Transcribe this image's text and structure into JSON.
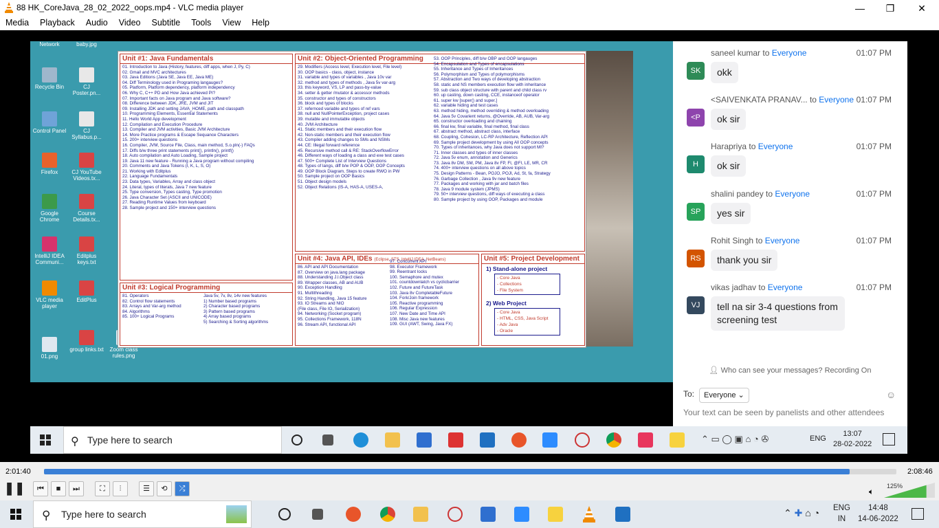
{
  "window": {
    "title": "88 HK_CoreJava_28_02_2022_oops.mp4 - VLC media player",
    "minimize": "—",
    "maximize": "❐",
    "close": "✕"
  },
  "menu": [
    "Media",
    "Playback",
    "Audio",
    "Video",
    "Subtitle",
    "Tools",
    "View",
    "Help"
  ],
  "desktop_icons": [
    {
      "label": "Network",
      "color": "#4a6fa5"
    },
    {
      "label": "baby.jpg",
      "color": "#d8c9a0"
    },
    {
      "label": "Recycle Bin",
      "color": "#9fb7cc"
    },
    {
      "label": "CJ Poster.pn...",
      "color": "#e8e8e8"
    },
    {
      "label": "Control Panel",
      "color": "#6fa3d8"
    },
    {
      "label": "CJ Syllabus.p...",
      "color": "#e8e8e8"
    },
    {
      "label": "Firefox",
      "color": "#e8622b"
    },
    {
      "label": "CJ YouTube Videos.tx...",
      "color": "#d94444"
    },
    {
      "label": "Google Chrome",
      "color": "#3c9a4a"
    },
    {
      "label": "Course Details.tx...",
      "color": "#d94444"
    },
    {
      "label": "IntelliJ IDEA Communi...",
      "color": "#d6336c"
    },
    {
      "label": "Editplus keys.txt",
      "color": "#d94444"
    },
    {
      "label": "VLC media player",
      "color": "#f08a00"
    },
    {
      "label": "EditPlus",
      "color": "#d94444"
    },
    {
      "label": "01.png",
      "color": "#dfe8f0"
    },
    {
      "label": "group links.txt",
      "color": "#d94444"
    },
    {
      "label": "Zoom class rules.png",
      "color": "#dfe8f0"
    }
  ],
  "slide": {
    "unit1": {
      "title": "Unit #1: Java Fundamentals",
      "items": [
        "01. Introduction to Java (History, features, diff apps, when J, Py, C)",
        "02. Gmail and MVC architectures",
        "03. Java Editions (Java SE, Java EE, Java ME)",
        "04. Diff Terminology used in Programing langauges?",
        "05. Platform, Platform dependency, platform independency",
        "06. Why C, C++ PD and How Java achieved PI?",
        "07. Important facts on Java program and Java software?",
        "08. Difference between JDK, JRE, JVM and JIT",
        "09. Installing JDK and setting JAVA_HOME, path and classpath",
        "10. Programming Elements, Essential Statements",
        "11. Hello World App development",
        "12. Compilation and Execution Procedure",
        "13. Compiler and JVM activities, Basic JVM Architecture",
        "14. More Practice programs & Escape Sequance Characters",
        "15. 200+ interview questions",
        "16. Compiler, JVM, Source File, Class, main method, S.o.pln(-) FAQs",
        "17. Diffs b/w three print statements print(), println(), printf()",
        "18. Auto compilation and Auto Loading, Sample project",
        "19. Java 11 new feature - Running a Java program without compiling",
        "20. Comments and Java Tokens (I, K, L, S, O)",
        "21. Working with Editplus",
        "22. Language Fundamentals",
        "23. Data types, Variables, Array and class object",
        "24. Literal, types of literals, Java 7 new feature",
        "25. Type conversion, Types casting, Type promotion",
        "26. Java Character Set (ASCII and UNICODE)",
        "27. Reading Runtime Values from keyboard",
        "28. Sample project and 150+ interview questions"
      ]
    },
    "unit2": {
      "title": "Unit #2: Object-Oriented Programming",
      "items": [
        "29. Modifiers (Access level, Execution level, File level)",
        "30. OOP basics - class, object, instance",
        "31. variable and types of variables , Java 10v var",
        "32. method and types of methods , Java 5v var-arg",
        "33. this keyword, VS, LP and pass-by-value",
        "34. setter & getter /mutator & accessor methods",
        "35. constructor and types of constructors",
        "36. block and types of blocks",
        "37. refernced variable and types of ref vars",
        "38. null and NullPointerException, project cases",
        "39. mutable and immutable objects",
        "40. JVM Architecture",
        "41. Static members and their execution flow",
        "42. Non-static members and their execution flow",
        "43. Compiler adding changes to SMs and NSMs",
        "44. CE: Illegal forward reference",
        "45. Recursive method call & RE: StackOverflowError",
        "46. Different ways of loading a class and exe test cases",
        "47. 500+ Complete List of Interview Questions",
        "48. Types of langs, diff b/w POP & OOP, OOP Concepts",
        "49. OOP Block Diagram, Steps to create RWO in PW",
        "50. Sample project on OOP Basics",
        "51. Object design models",
        "52. Object Relations (IS-A, HAS-A, USES-A,"
      ]
    },
    "unit2b": {
      "items": [
        "53. OOP Principles, diff b/w OBP and OOP langauges",
        "54. Encapsulation and Types of encapsulations",
        "55. Inheritance and Types of Inheritances",
        "56. Polymorphism and Types of polymorphisms",
        "57. Abstraction and Two ways of developing abstraction",
        "58. static and NS members execution flow with inheritance",
        "59. sub class object structure with parent and child class rv",
        "60. up casting, down casting, CCE, instanceof operator",
        "61. super kw [super() and super.]",
        "62. variable hiding and test cases",
        "63. method hiding, method overriding & method overloading",
        "64. Java 5v Covarient returns, @Override, AB, AUB, Var-arg",
        "65. constructor overloading and chaining",
        "66. final kw, final variable, final method, final class",
        "67. abstract method, abstract class, interface",
        "68. Coupling, Cohesion, LC-RP Architecture, Reflection API",
        "69. Sample project development by using All OOP concepts",
        "70. Types of inheritances, why Java does not support MI?",
        "71. Inner classes and types of inner classes",
        "72. Java 5v enum, annotation and Generics",
        "73. Java 8v DM, SM, PM, Java 8v FP, FI, @FI, LE, MR, CR",
        "74. 400+ interview questions on all above topics",
        "75. Design Patterns - Bean, POJO, POJI, Ad, St, fa, Strategy",
        "76. Garbage Collection , Java 9v new feature",
        "77. Packages and working with jar and batch files",
        "78. Java 9 module system (JPMS)",
        "79. 50+ interview questions, diff ways of executing a class",
        "80. Sample project by using OOP, Packages and module"
      ]
    },
    "unit3": {
      "title": "Unit #3: Logical Programming",
      "items": [
        "81. Operators",
        "82. Control flow statements",
        "83. Arrays and Var-arg method",
        "84. Algorithms",
        "85. 100+ Logical Programs"
      ],
      "sub": [
        "Java 5v, 7v, 8v, 14v new features",
        "1) Number based programs",
        "2) Character based programs",
        "3) Pattern based programs",
        "4) Array based programs",
        "5) Searching & Sorting algorithms"
      ]
    },
    "unit4": {
      "title": "Unit #4: Java API, IDEs",
      "subtitle": "(Eclipse, STS, IntelliJ IDEA, NetBeans)",
      "items": [
        "86. API and API Documentation",
        "87. Overview on java.lang package",
        "88. Understanding J.l.Object class",
        "89. Wrapper classes, AB and AUB",
        "90. Exception Handling",
        "91. Multithreading",
        "92. String Handling, Java 15 feature",
        "93. IO Streams and NIO",
        "(File class, File IO, Serialization)",
        "94. Networking (Socket program)",
        "95. Collections Framework, 118N",
        "96. Stream API, functional API"
      ],
      "items2": [
        "97. Concurrent API",
        "98. Executor Framework",
        "99. Reentrant locks",
        "100. Semaphore and mutex",
        "101. countdownlatch vs cyclicbarrier",
        "102. Future and FutureTask",
        "103. Java 8v CompletableFuture",
        "104. Fork/Join framework",
        "105. Reactive programming",
        "106. Regular Expression",
        "107. New Date and Time API",
        "108. Misc Java new features",
        "109. GUI (AWT, Swing, Java FX)"
      ]
    },
    "unit5": {
      "title": "Unit #5: Project Development",
      "standalone": "1) Stand-alone project",
      "standalone_items": [
        "- Core Java",
        "- Collections",
        "- File System"
      ],
      "web": "2) Web Project",
      "web_items": [
        "- Core Java",
        "- HTML, CSS, Java Script",
        "- Adv Java",
        "- Oracle"
      ]
    }
  },
  "video_taskbar": {
    "search_placeholder": "Type here to search",
    "time": "13:07",
    "date": "28-02-2022",
    "lang": "ENG"
  },
  "chat": {
    "messages": [
      {
        "from": "saneel kumar",
        "to": "Everyone",
        "time": "01:07 PM",
        "initials": "SK",
        "color": "#2e8b57",
        "text": "okk"
      },
      {
        "from": "<SAIVENKATA PRANAV...",
        "to": "Everyone",
        "time": "01:07 PM",
        "initials": "<P",
        "color": "#8e44ad",
        "text": "ok sir"
      },
      {
        "from": "Harapriya",
        "to": "Everyone",
        "time": "01:07 PM",
        "initials": "H",
        "color": "#1e8a6e",
        "text": "ok sir"
      },
      {
        "from": "shalini pandey",
        "to": "Everyone",
        "time": "01:07 PM",
        "initials": "SP",
        "color": "#27a35a",
        "text": "yes sir"
      },
      {
        "from": "Rohit Singh",
        "to": "Everyone",
        "time": "01:07 PM",
        "initials": "RS",
        "color": "#d35400",
        "text": "thank you sir"
      },
      {
        "from": "vikas jadhav",
        "to": "Everyone",
        "time": "01:07 PM",
        "initials": "VJ",
        "color": "#34495e",
        "text": "tell na sir 3-4 questions from screening test"
      }
    ],
    "to_word": "to",
    "who_can_see": "Who can see your messages? Recording On",
    "to_label": "To:",
    "recipient": "Everyone",
    "hint": "Your text can be seen by panelists and other attendees"
  },
  "player": {
    "elapsed": "2:01:40",
    "total": "2:08:46",
    "progress": 0.945,
    "volume_pct": "125%",
    "volume": 1.25
  },
  "taskbar": {
    "search_placeholder": "Type here to search",
    "time": "14:48",
    "date": "14-06-2022",
    "lang1": "ENG",
    "lang2": "IN"
  }
}
